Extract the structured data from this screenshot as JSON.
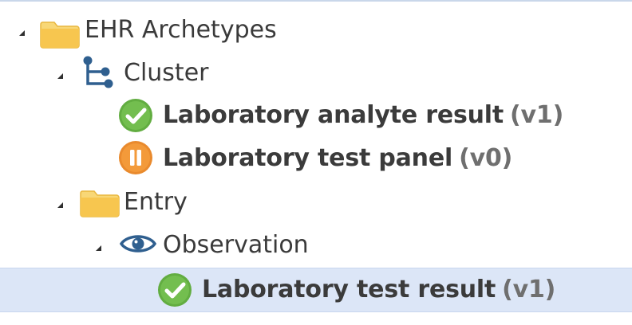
{
  "tree": {
    "root": {
      "label": "EHR Archetypes",
      "icon": "folder-icon",
      "expanded": true
    },
    "cluster": {
      "label": "Cluster",
      "icon": "hierarchy-icon",
      "expanded": true
    },
    "analyte": {
      "label": "Laboratory analyte result",
      "version": "(v1)",
      "status_icon": "checkmark-icon",
      "status_color": "#6ab04c"
    },
    "panel": {
      "label": "Laboratory test panel",
      "version": "(v0)",
      "status_icon": "pause-icon",
      "status_color": "#f39a3a"
    },
    "entry": {
      "label": "Entry",
      "icon": "folder-icon",
      "expanded": true
    },
    "observation": {
      "label": "Observation",
      "icon": "eye-icon",
      "expanded": true
    },
    "test_result": {
      "label": "Laboratory test result",
      "version": "(v1)",
      "status_icon": "checkmark-icon",
      "status_color": "#6ab04c",
      "selected": true
    }
  },
  "colors": {
    "folder": "#f7c64f",
    "hierarchy": "#2f5f8f",
    "eye": "#2f5f8f",
    "selection": "#dce6f7"
  }
}
